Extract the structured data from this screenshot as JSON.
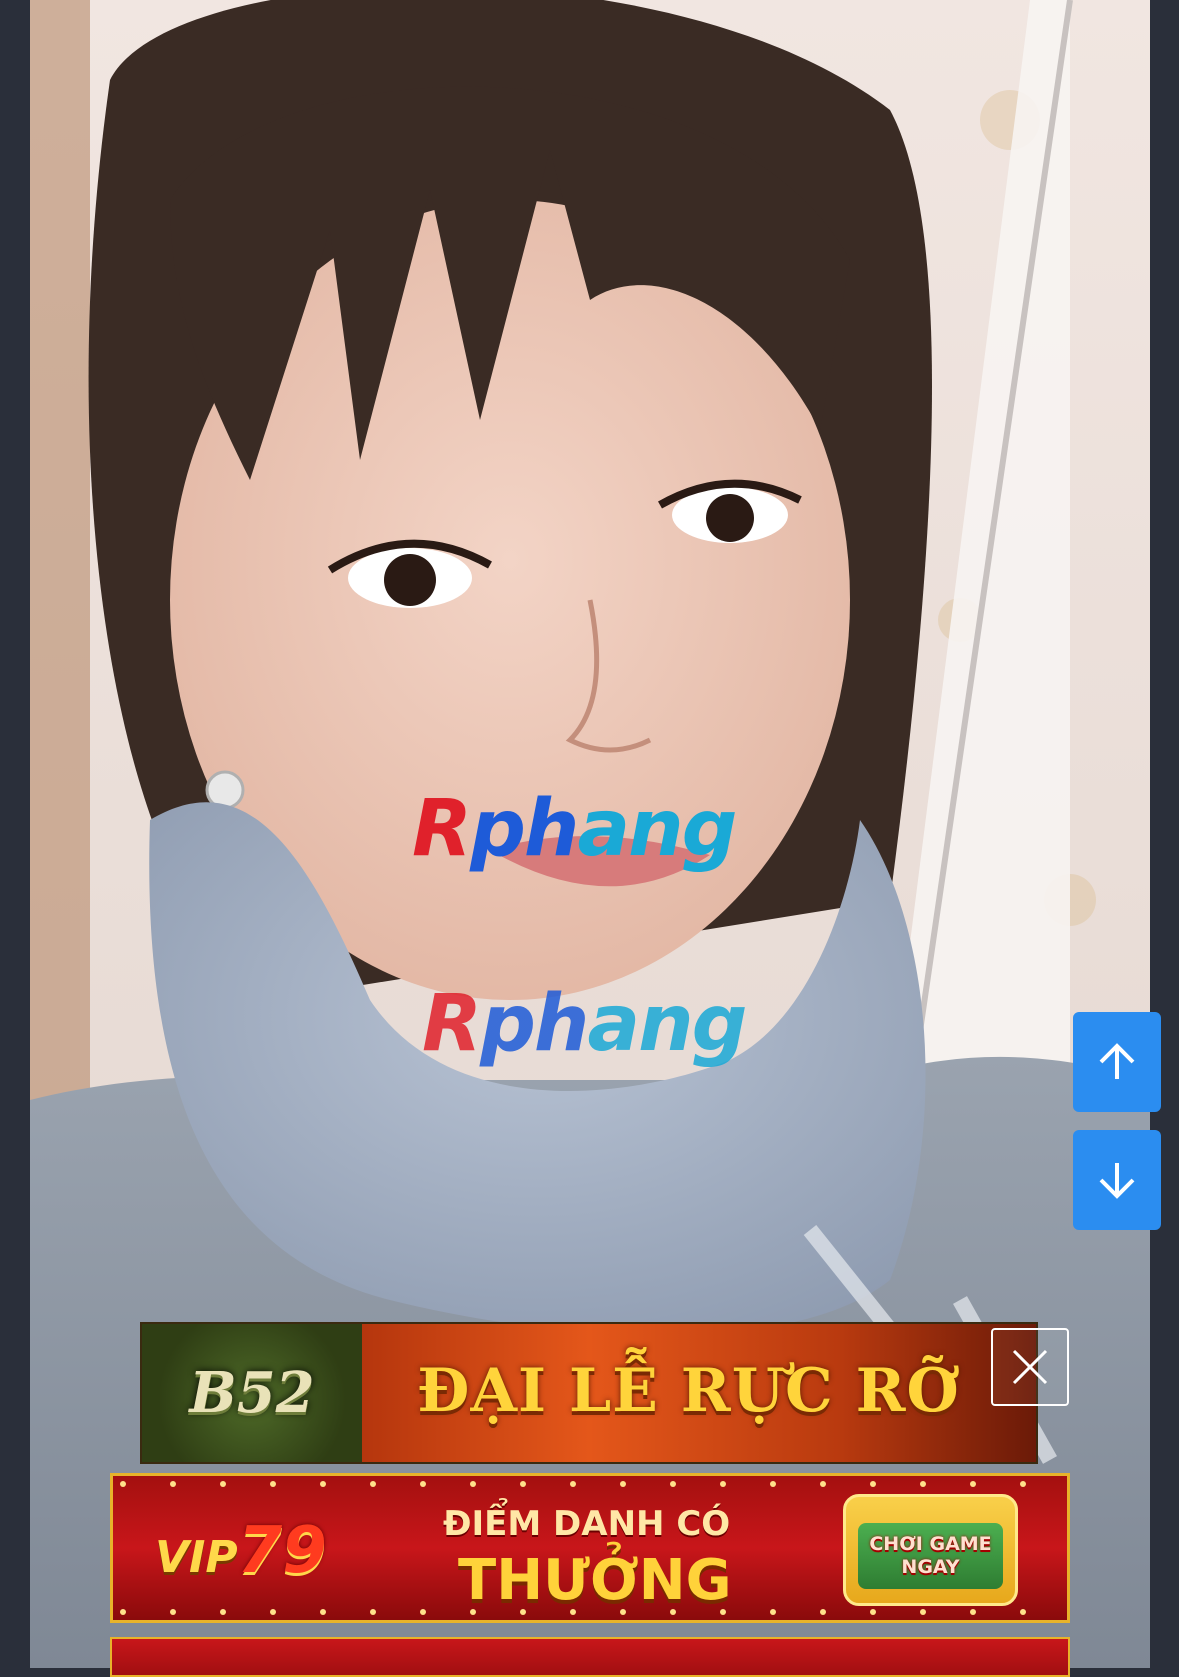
{
  "watermark": {
    "text": "Rphang"
  },
  "navigation": {
    "scroll_up_label": "scroll-up",
    "scroll_down_label": "scroll-down"
  },
  "ads": [
    {
      "brand": "B52",
      "headline": "ĐẠI LỄ RỰC RỠ"
    },
    {
      "brand_prefix": "VIP",
      "brand_number": "79",
      "line1": "ĐIỂM DANH CÓ",
      "line2": "THƯỞNG",
      "cta_line1": "CHƠI GAME",
      "cta_line2": "NGAY"
    }
  ],
  "colors": {
    "nav_button": "#2b8df0",
    "watermark_red": "#e0212b",
    "watermark_blue": "#1e5bd8",
    "banner_gold": "#ffd43b"
  }
}
